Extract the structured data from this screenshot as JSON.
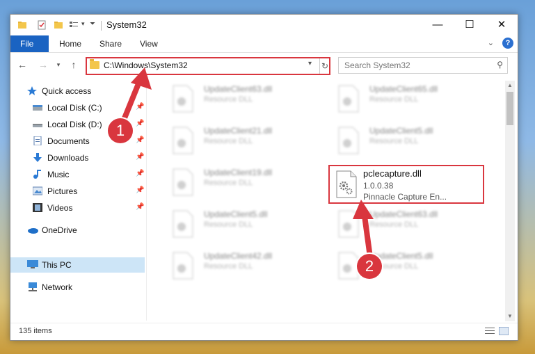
{
  "window": {
    "title": "System32"
  },
  "ribbon": {
    "tabs": [
      "File",
      "Home",
      "Share",
      "View"
    ]
  },
  "window_controls": {
    "minimize": "—",
    "maximize": "☐",
    "close": "✕"
  },
  "address_bar": {
    "path": "C:\\Windows\\System32"
  },
  "search": {
    "placeholder": "Search System32"
  },
  "sidebar": {
    "items": [
      {
        "label": "Quick access",
        "icon": "star-icon",
        "pinned": false
      },
      {
        "label": "Local Disk (C:)",
        "icon": "drive-icon",
        "pinned": true
      },
      {
        "label": "Local Disk (D:)",
        "icon": "drive-icon",
        "pinned": true
      },
      {
        "label": "Documents",
        "icon": "documents-icon",
        "pinned": true
      },
      {
        "label": "Downloads",
        "icon": "downloads-icon",
        "pinned": true
      },
      {
        "label": "Music",
        "icon": "music-icon",
        "pinned": true
      },
      {
        "label": "Pictures",
        "icon": "pictures-icon",
        "pinned": true
      },
      {
        "label": "Videos",
        "icon": "videos-icon",
        "pinned": true
      },
      {
        "label": "OneDrive",
        "icon": "onedrive-icon",
        "pinned": false
      },
      {
        "label": "This PC",
        "icon": "computer-icon",
        "pinned": false,
        "selected": true
      },
      {
        "label": "Network",
        "icon": "network-icon",
        "pinned": false
      }
    ]
  },
  "files": [
    {
      "name": "UpdateClient63.dll",
      "desc": "Resource DLL"
    },
    {
      "name": "UpdateClient65.dll",
      "desc": "Resource DLL"
    },
    {
      "name": "UpdateClient21.dll",
      "desc": "Resource DLL"
    },
    {
      "name": "UpdateClient5.dll",
      "desc": "Resource DLL"
    },
    {
      "name": "UpdateClient19.dll",
      "desc": "Resource DLL"
    },
    {
      "name": "UpdateClient5.dll",
      "desc": "Resource DLL"
    },
    {
      "name": "UpdateClient63.dll",
      "desc": "Resource DLL"
    },
    {
      "name": "UpdateClient42.dll",
      "desc": "Resource DLL"
    },
    {
      "name": "UpdateClient5.dll",
      "desc": "Resource DLL"
    }
  ],
  "highlighted_file": {
    "name": "pclecapture.dll",
    "version": "1.0.0.38",
    "company": "Pinnacle Capture En..."
  },
  "status_bar": {
    "item_count": "135 items"
  },
  "annotations": {
    "step1": "1",
    "step2": "2",
    "color": "#d9363e"
  }
}
